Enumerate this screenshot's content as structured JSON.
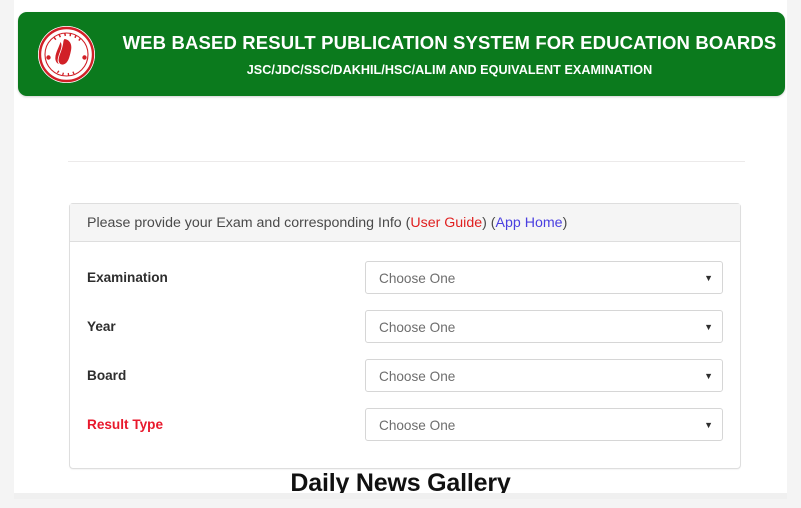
{
  "banner": {
    "logo_icon": "bangladesh-government-emblem-icon",
    "title": "WEB BASED RESULT PUBLICATION SYSTEM FOR EDUCATION BOARDS",
    "subtitle": "JSC/JDC/SSC/DAKHIL/HSC/ALIM AND EQUIVALENT EXAMINATION",
    "background_color": "#0b7a1d",
    "text_color": "#ffffff"
  },
  "form_card": {
    "header": {
      "intro_text": "Please provide your Exam and corresponding Info ",
      "open_paren_1": "(",
      "user_guide_link": "User Guide",
      "close_paren_1": ") ",
      "open_paren_2": "(",
      "app_home_link": "App Home",
      "close_paren_2": ")"
    },
    "rows": [
      {
        "label": "Examination",
        "label_color": "#2e2e2e",
        "select_value": "Choose One",
        "caret_icon": "chevron-down-icon"
      },
      {
        "label": "Year",
        "label_color": "#2e2e2e",
        "select_value": "Choose One",
        "caret_icon": "chevron-down-icon"
      },
      {
        "label": "Board",
        "label_color": "#2e2e2e",
        "select_value": "Choose One",
        "caret_icon": "chevron-down-icon"
      },
      {
        "label": "Result Type",
        "label_color": "#e8192c",
        "select_value": "Choose One",
        "caret_icon": "chevron-down-icon"
      }
    ]
  },
  "gallery": {
    "heading": "Daily News Gallery"
  },
  "colors": {
    "brand_green": "#0b7a1d",
    "accent_red": "#e8192c",
    "link_red": "#e02020",
    "link_blue": "#4a3fe0",
    "page_background": "#f4f4f4",
    "card_header_background": "#f5f5f5",
    "border": "#dedede"
  },
  "icons": {
    "caret": "▼"
  }
}
